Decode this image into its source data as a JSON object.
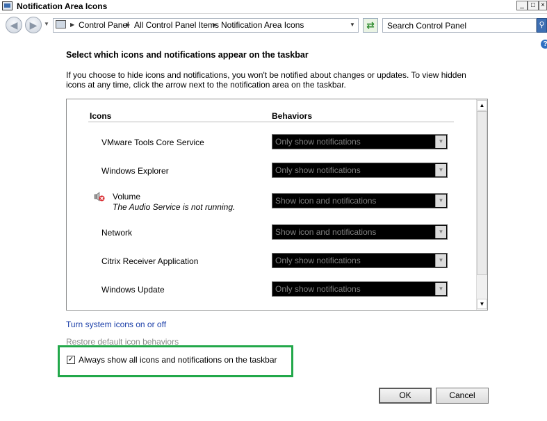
{
  "window": {
    "title": "Notification Area Icons",
    "buttons": {
      "minimize": "_",
      "maximize": "□",
      "close": "×"
    }
  },
  "address_bar": {
    "breadcrumbs": [
      "Control Panel",
      "All Control Panel Items",
      "Notification Area Icons"
    ],
    "search_placeholder": "Search Control Panel"
  },
  "page": {
    "heading": "Select which icons and notifications appear on the taskbar",
    "description": "If you choose to hide icons and notifications, you won't be notified about changes or updates. To view hidden icons at any time, click the arrow next to the notification area on the taskbar."
  },
  "table": {
    "col_icons": "Icons",
    "col_behaviors": "Behaviors",
    "rows": [
      {
        "name": "VMware Tools Core Service",
        "behavior": "Only show notifications"
      },
      {
        "name": "Windows Explorer",
        "behavior": "Only show notifications"
      },
      {
        "name": "Volume",
        "subtext": "The Audio Service is not running.",
        "behavior": "Show icon and notifications",
        "icon": "speaker-error-icon"
      },
      {
        "name": "Network",
        "behavior": "Show icon and notifications"
      },
      {
        "name": "Citrix Receiver Application",
        "behavior": "Only show notifications"
      },
      {
        "name": "Windows Update",
        "behavior": "Only show notifications"
      }
    ]
  },
  "links": {
    "system_icons": "Turn system icons on or off",
    "restore": "Restore default icon behaviors"
  },
  "options": {
    "always_show_label": "Always show all icons and notifications on the taskbar",
    "always_show_checked": true
  },
  "buttons": {
    "ok": "OK",
    "cancel": "Cancel"
  },
  "colors": {
    "highlight": "#22a84a",
    "link": "#1a3ea8"
  }
}
